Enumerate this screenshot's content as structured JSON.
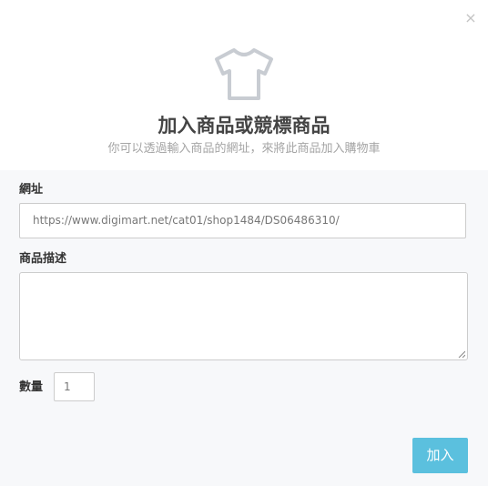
{
  "dialog": {
    "close_symbol": "×",
    "icon": "tshirt-icon",
    "title": "加入商品或競標商品",
    "subtitle": "你可以透過輸入商品的網址，來將此商品加入購物車"
  },
  "form": {
    "url_label": "網址",
    "url_value": "https://www.digimart.net/cat01/shop1484/DS06486310/",
    "description_label": "商品描述",
    "description_value": "",
    "quantity_label": "數量",
    "quantity_value": "1",
    "submit_label": "加入"
  },
  "colors": {
    "accent": "#5bc0de",
    "icon": "#c8ccd2",
    "form_background": "#f7f8fa"
  }
}
